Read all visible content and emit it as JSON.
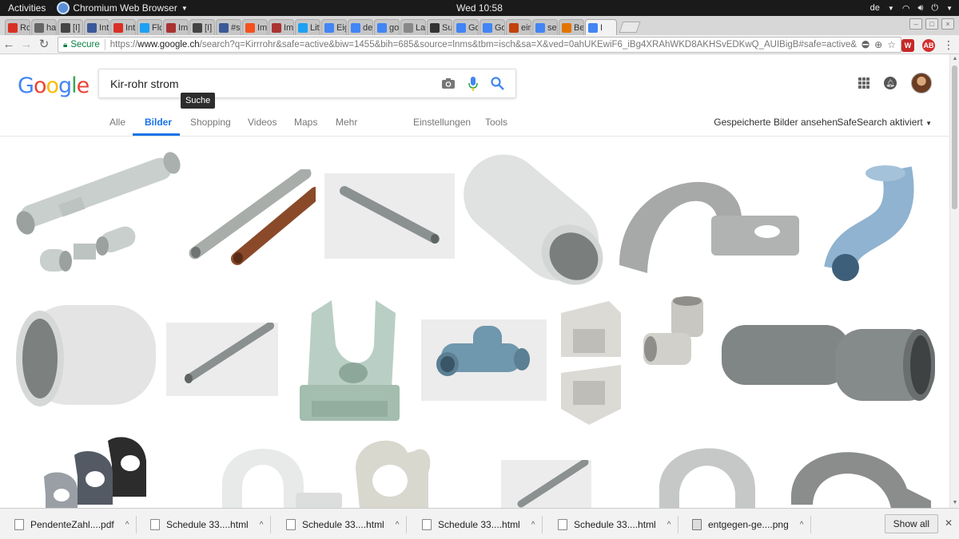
{
  "system_bar": {
    "activities": "Activities",
    "app_name": "Chromium Web Browser",
    "clock": "Wed 10:58",
    "keyboard_layout": "de"
  },
  "tabs": [
    {
      "label": "Ron",
      "color": "#d93025"
    },
    {
      "label": "hac",
      "color": "#666666"
    },
    {
      "label": "[I] (",
      "color": "#444444"
    },
    {
      "label": "Intr",
      "color": "#3b5998"
    },
    {
      "label": "Intr",
      "color": "#d93025"
    },
    {
      "label": "Flo",
      "color": "#1da1f2"
    },
    {
      "label": "Ima",
      "color": "#a33"
    },
    {
      "label": "[I] (",
      "color": "#444444"
    },
    {
      "label": "#st",
      "color": "#3b5998"
    },
    {
      "label": "Ima",
      "color": "#f4511e"
    },
    {
      "label": "Ima",
      "color": "#a33"
    },
    {
      "label": "Litt",
      "color": "#1da1f2"
    },
    {
      "label": "Eig",
      "color": "#4285f4"
    },
    {
      "label": "det",
      "color": "#4285f4"
    },
    {
      "label": "gol",
      "color": "#4285f4"
    },
    {
      "label": "Lan",
      "color": "#888888"
    },
    {
      "label": "Sup",
      "color": "#333333"
    },
    {
      "label": "Goo",
      "color": "#4285f4"
    },
    {
      "label": "Goo",
      "color": "#4285f4"
    },
    {
      "label": "ein",
      "color": "#c2410c"
    },
    {
      "label": "set",
      "color": "#4285f4"
    },
    {
      "label": "Bet",
      "color": "#e37400"
    },
    {
      "label": "I",
      "color": "#4285f4",
      "active": true
    }
  ],
  "toolbar": {
    "secure_label": "Secure",
    "url_scheme": "https://",
    "url_host": "www.google.ch",
    "url_rest": "/search?q=Kirrrohr&safe=active&biw=1455&bih=685&source=lnms&tbm=isch&sa=X&ved=0ahUKEwiF6_iBg4XRAhWKD8AKHSvEDKwQ_AUIBigB#safe=active&tbm=isch&"
  },
  "google": {
    "logo_text": "Google",
    "query": "Kir-rohr strom",
    "tooltip": "Suche",
    "nav_tabs": [
      "Alle",
      "Bilder",
      "Shopping",
      "Videos",
      "Maps",
      "Mehr",
      "Einstellungen",
      "Tools"
    ],
    "saved_images": "Gespeicherte Bilder ansehen",
    "safesearch": "SafeSearch aktiviert"
  },
  "images": [
    {
      "name": "pipe-set-with-clips"
    },
    {
      "name": "grey-and-brown-tubes"
    },
    {
      "name": "grey-tube-on-grey"
    },
    {
      "name": "large-white-pipe"
    },
    {
      "name": "grey-saddle-clip"
    },
    {
      "name": "blue-pipe-bend"
    },
    {
      "name": "white-pipe-coupler"
    },
    {
      "name": "thin-grey-tube"
    },
    {
      "name": "green-snap-clip"
    },
    {
      "name": "blue-tee-fitting"
    },
    {
      "name": "white-corner-fittings"
    },
    {
      "name": "elbow-fitting"
    },
    {
      "name": "grey-sleeve-coupler"
    },
    {
      "name": "multi-size-clips"
    },
    {
      "name": "white-saddle-clip"
    },
    {
      "name": "beige-snap-clip"
    },
    {
      "name": "grey-tube-small"
    },
    {
      "name": "light-saddle-clip"
    },
    {
      "name": "dark-saddle-clip"
    }
  ],
  "downloads": [
    {
      "label": "PendenteZahl....pdf",
      "kind": "pdf"
    },
    {
      "label": "Schedule 33....html",
      "kind": "html"
    },
    {
      "label": "Schedule 33....html",
      "kind": "html"
    },
    {
      "label": "Schedule 33....html",
      "kind": "html"
    },
    {
      "label": "Schedule 33....html",
      "kind": "html"
    },
    {
      "label": "entgegen-ge....png",
      "kind": "png"
    }
  ],
  "show_all": "Show all"
}
